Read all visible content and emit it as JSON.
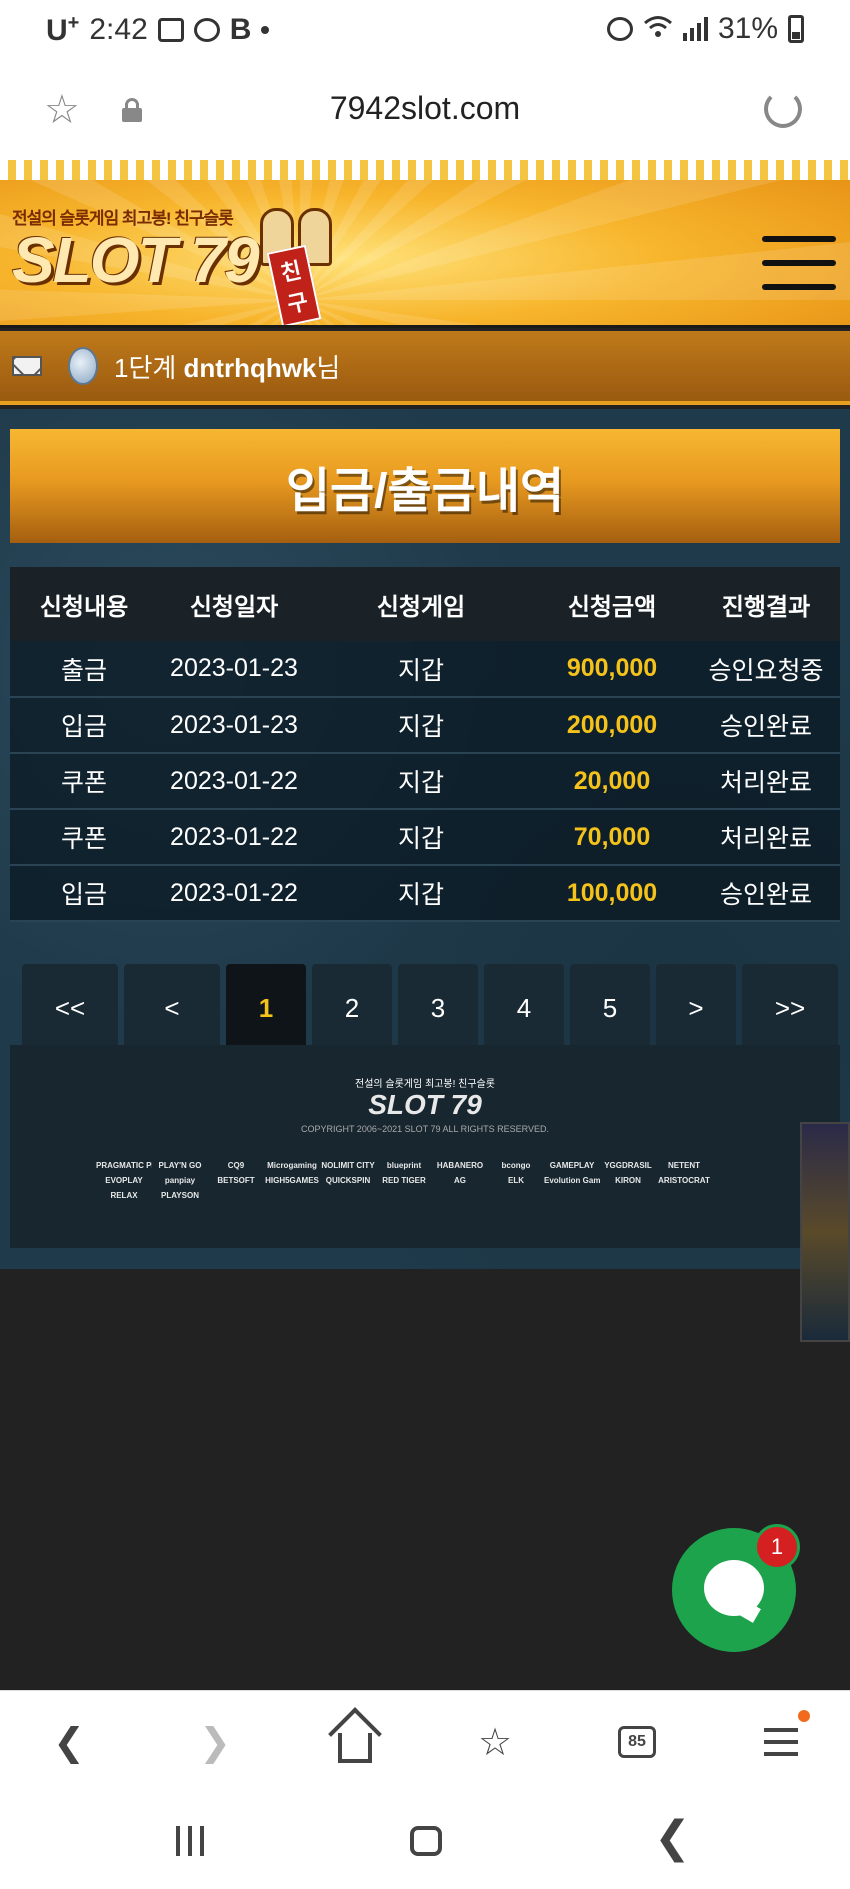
{
  "status_bar": {
    "carrier": "U",
    "carrier_sup": "+",
    "time": "2:42",
    "bold_icon": "B",
    "battery": "31%",
    "icons": [
      "gallery-icon",
      "alien-icon",
      "alarm-icon",
      "wifi-icon",
      "signal-icon",
      "battery-icon"
    ]
  },
  "browser": {
    "url": "7942slot.com",
    "tab_count": "85"
  },
  "site": {
    "tagline": "전설의 슬롯게임 최고봉! 친구슬롯",
    "logo_name": "SLOT 79",
    "logo_badge": "친구",
    "user_level": "1단계",
    "user_name": "dntrhqhwk",
    "user_suffix": "님",
    "page_title": "입금/출금내역"
  },
  "table": {
    "headers": [
      "신청내용",
      "신청일자",
      "신청게임",
      "신청금액",
      "진행결과"
    ],
    "rows": [
      [
        "출금",
        "2023-01-23",
        "지갑",
        "900,000",
        "승인요청중"
      ],
      [
        "입금",
        "2023-01-23",
        "지갑",
        "200,000",
        "승인완료"
      ],
      [
        "쿠폰",
        "2023-01-22",
        "지갑",
        "20,000",
        "처리완료"
      ],
      [
        "쿠폰",
        "2023-01-22",
        "지갑",
        "70,000",
        "처리완료"
      ],
      [
        "입금",
        "2023-01-22",
        "지갑",
        "100,000",
        "승인완료"
      ]
    ]
  },
  "pager": {
    "first": "<<",
    "prev": "<",
    "pages": [
      "1",
      "2",
      "3",
      "4",
      "5"
    ],
    "active": "1",
    "next": ">",
    "last": ">>"
  },
  "footer": {
    "tagline": "전설의 슬롯게임 최고봉! 친구슬롯",
    "logo_name": "SLOT 79",
    "copyright": "COPYRIGHT 2006~2021 SLOT 79 ALL RIGHTS RESERVED.",
    "providers": [
      "PRAGMATIC PLAY",
      "PLAY'N GO",
      "CQ9",
      "Microgaming",
      "NOLIMIT CITY",
      "blueprint",
      "HABANERO",
      "bcongo",
      "GAMEPLAY",
      "YGGDRASIL",
      "NETENT",
      "EVOPLAY",
      "panpiay",
      "BETSOFT",
      "HIGH5GAMES",
      "QUICKSPIN",
      "RED TIGER",
      "AG",
      "ELK",
      "Evolution Gaming",
      "KIRON",
      "ARISTOCRAT",
      "RELAX",
      "PLAYSON"
    ]
  },
  "chat": {
    "badge_count": "1"
  },
  "colors": {
    "accent_gold": "#f4c21a",
    "chat_green": "#1ca34c",
    "badge_red": "#d42020"
  }
}
